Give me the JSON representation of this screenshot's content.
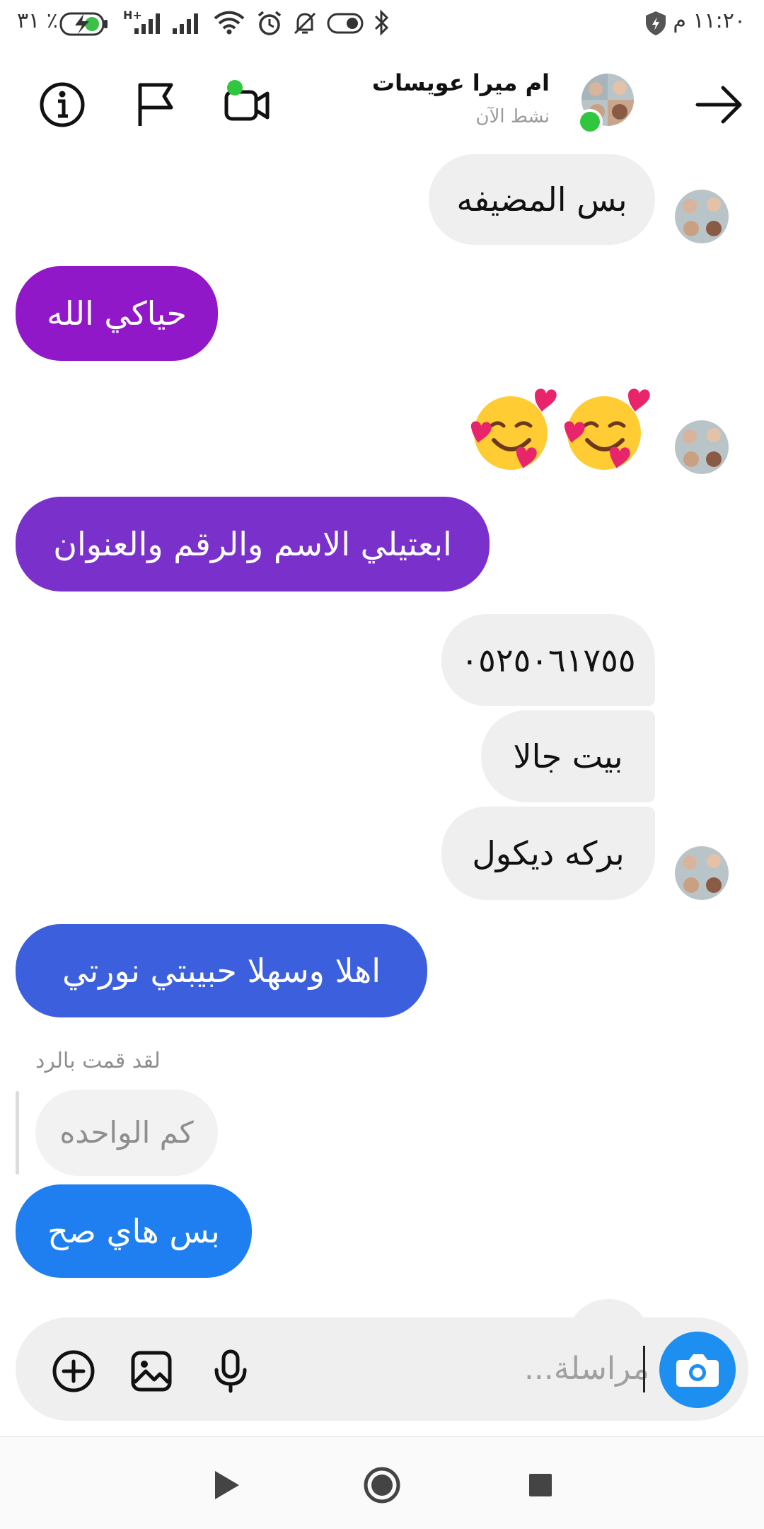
{
  "status_bar": {
    "time": "١١:٢٠ م",
    "battery_percent": "٣١ ٪",
    "network": "H+"
  },
  "header": {
    "contact_name": "ام ميرا عويسات",
    "contact_status": "نشط الآن",
    "icons": [
      "back-arrow-icon",
      "video-call-icon",
      "flag-icon",
      "info-icon"
    ],
    "online_color": "#30c640"
  },
  "messages": [
    {
      "id": 1,
      "direction": "incoming",
      "text": "بس المضيفه"
    },
    {
      "id": 2,
      "direction": "outgoing",
      "text": "حياكي الله",
      "color": "#9118c9"
    },
    {
      "id": 3,
      "direction": "incoming",
      "emoji": [
        "smiling-face-with-hearts",
        "smiling-face-with-hearts"
      ]
    },
    {
      "id": 4,
      "direction": "outgoing",
      "text": "ابعتيلي الاسم والرقم والعنوان",
      "color": "#7a31cc"
    },
    {
      "id": 5,
      "direction": "incoming",
      "text": "٠٥٢٥٠٦١٧٥٥"
    },
    {
      "id": 6,
      "direction": "incoming",
      "text": "بيت جالا"
    },
    {
      "id": 7,
      "direction": "incoming",
      "text": "بركه ديكول"
    },
    {
      "id": 8,
      "direction": "outgoing",
      "text": "اهلا وسهلا حبيبتي نورتي",
      "color": "#3c5fdd"
    },
    {
      "id": 9,
      "direction": "outgoing",
      "reply_label": "لقد قمت بالرد",
      "quoted_text": "كم الواحده",
      "text": "بس هاي صح",
      "color": "#1f7ef0"
    }
  ],
  "composer": {
    "placeholder": "مراسلة...",
    "icons": [
      "camera-icon",
      "microphone-icon",
      "gallery-icon",
      "plus-icon"
    ],
    "camera_color": "#1d8ff0"
  },
  "nav_bar": {
    "icons": [
      "back-icon",
      "home-icon",
      "recents-icon"
    ]
  }
}
